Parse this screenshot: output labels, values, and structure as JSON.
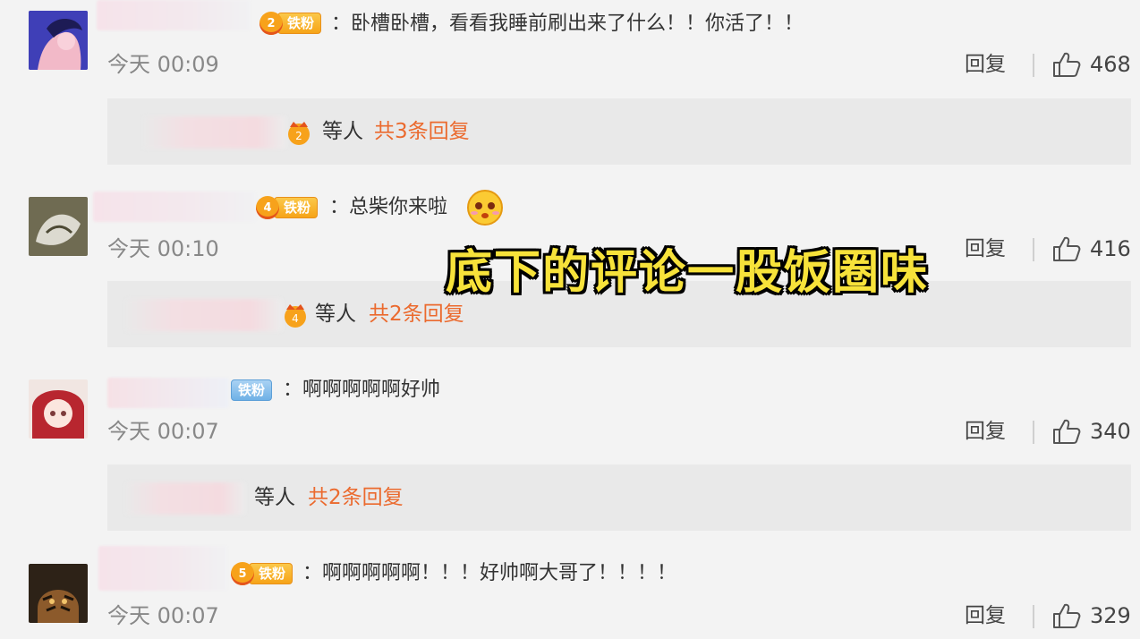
{
  "comments": [
    {
      "badge_level": "2",
      "badge_label": "铁粉",
      "text": "卧槽卧槽，看看我睡前刷出来了什么！！你活了！！",
      "time": "今天 00:09",
      "reply_label": "回复",
      "likes": "468",
      "replies": {
        "who": "等人",
        "count": "共3条回复"
      }
    },
    {
      "badge_level": "4",
      "badge_label": "铁粉",
      "text": "总柴你来啦",
      "time": "今天 00:10",
      "reply_label": "回复",
      "likes": "416",
      "replies": {
        "who": "等人",
        "count": "共2条回复"
      }
    },
    {
      "badge_label": "铁粉",
      "text": "啊啊啊啊啊好帅",
      "time": "今天 00:07",
      "reply_label": "回复",
      "likes": "340",
      "replies": {
        "who": "等人",
        "count": "共2条回复"
      }
    },
    {
      "badge_level": "5",
      "badge_label": "铁粉",
      "text": "啊啊啊啊啊！！！好帅啊大哥了！！！！",
      "time": "今天 00:07",
      "reply_label": "回复",
      "likes": "329"
    }
  ],
  "overlay_caption": "底下的评论一股饭圈味",
  "colors": {
    "link_orange": "#eb6a2e",
    "caption_yellow": "#f7e23a",
    "badge_orange": "#f6a418",
    "badge_blue": "#6fb1e6"
  }
}
